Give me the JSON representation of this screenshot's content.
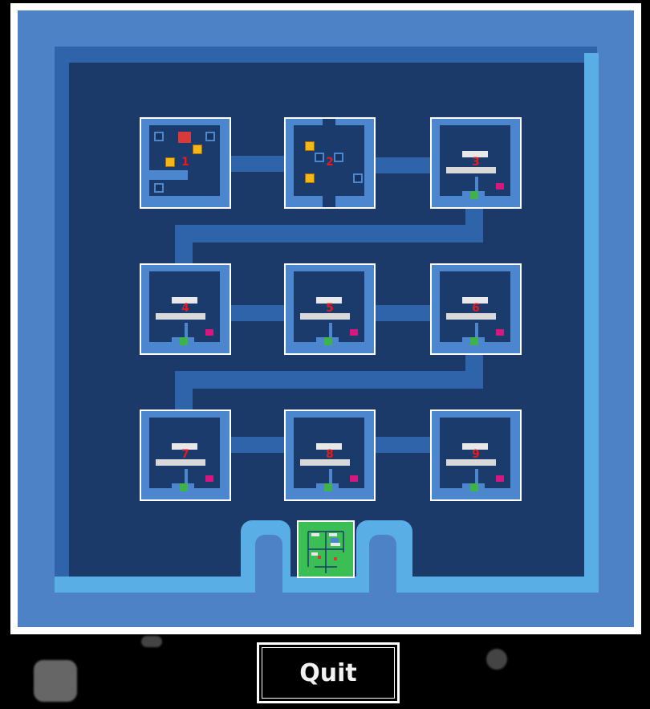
{
  "game": {
    "title_hidden": "",
    "rooms": [
      {
        "id": "room-1",
        "label": "1"
      },
      {
        "id": "room-2",
        "label": "2"
      },
      {
        "id": "room-3",
        "label": "3"
      },
      {
        "id": "room-4",
        "label": "4"
      },
      {
        "id": "room-5",
        "label": "5"
      },
      {
        "id": "room-6",
        "label": "6"
      },
      {
        "id": "room-7",
        "label": "7"
      },
      {
        "id": "room-8",
        "label": "8"
      },
      {
        "id": "room-9",
        "label": "9"
      }
    ]
  },
  "controls": {
    "quit_label": "Quit"
  },
  "colors": {
    "wall_light": "#5aaee6",
    "wall_mid": "#4d83c6",
    "floor": "#1b3a6a",
    "corridor": "#2f64ab",
    "room_number": "#e51c1c",
    "goal_room": "#3bbf55",
    "player": "#d63a3a",
    "crate": "#f4b718",
    "marker": "#d6187e"
  }
}
